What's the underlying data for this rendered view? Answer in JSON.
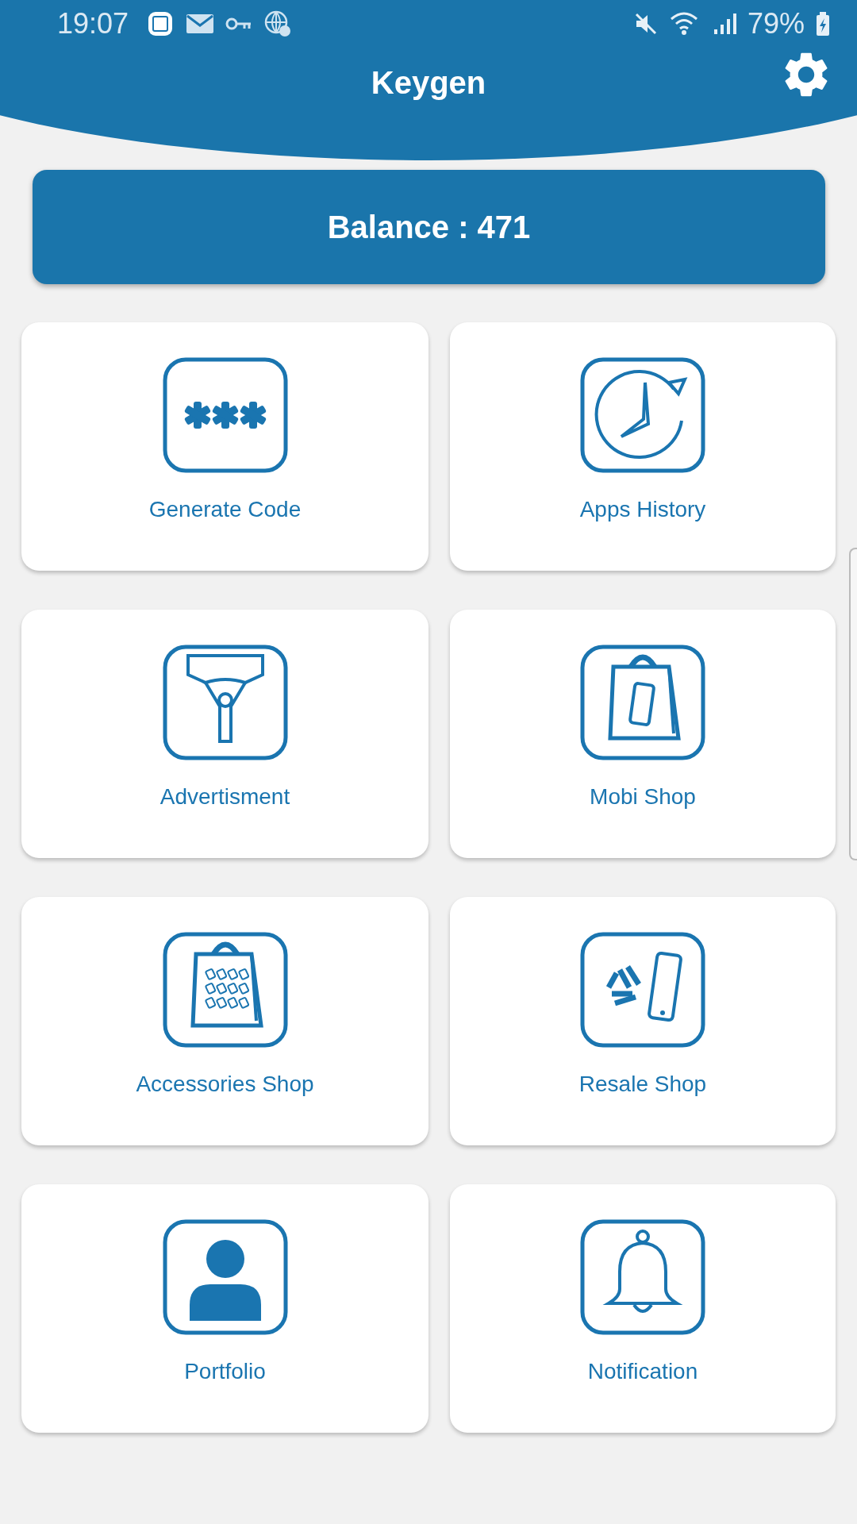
{
  "status_bar": {
    "time": "19:07",
    "battery": "79%"
  },
  "app_bar": {
    "title": "Keygen"
  },
  "balance": {
    "text": "Balance : 471"
  },
  "tiles": [
    {
      "label": "Generate Code",
      "kind": "code"
    },
    {
      "label": "Apps History",
      "kind": "history"
    },
    {
      "label": "Advertisment",
      "kind": "advert"
    },
    {
      "label": "Mobi Shop",
      "kind": "mobile_shop"
    },
    {
      "label": "Accessories Shop",
      "kind": "accessories"
    },
    {
      "label": "Resale Shop",
      "kind": "resale"
    },
    {
      "label": "Portfolio",
      "kind": "portfolio"
    },
    {
      "label": "Notification",
      "kind": "notification"
    }
  ]
}
